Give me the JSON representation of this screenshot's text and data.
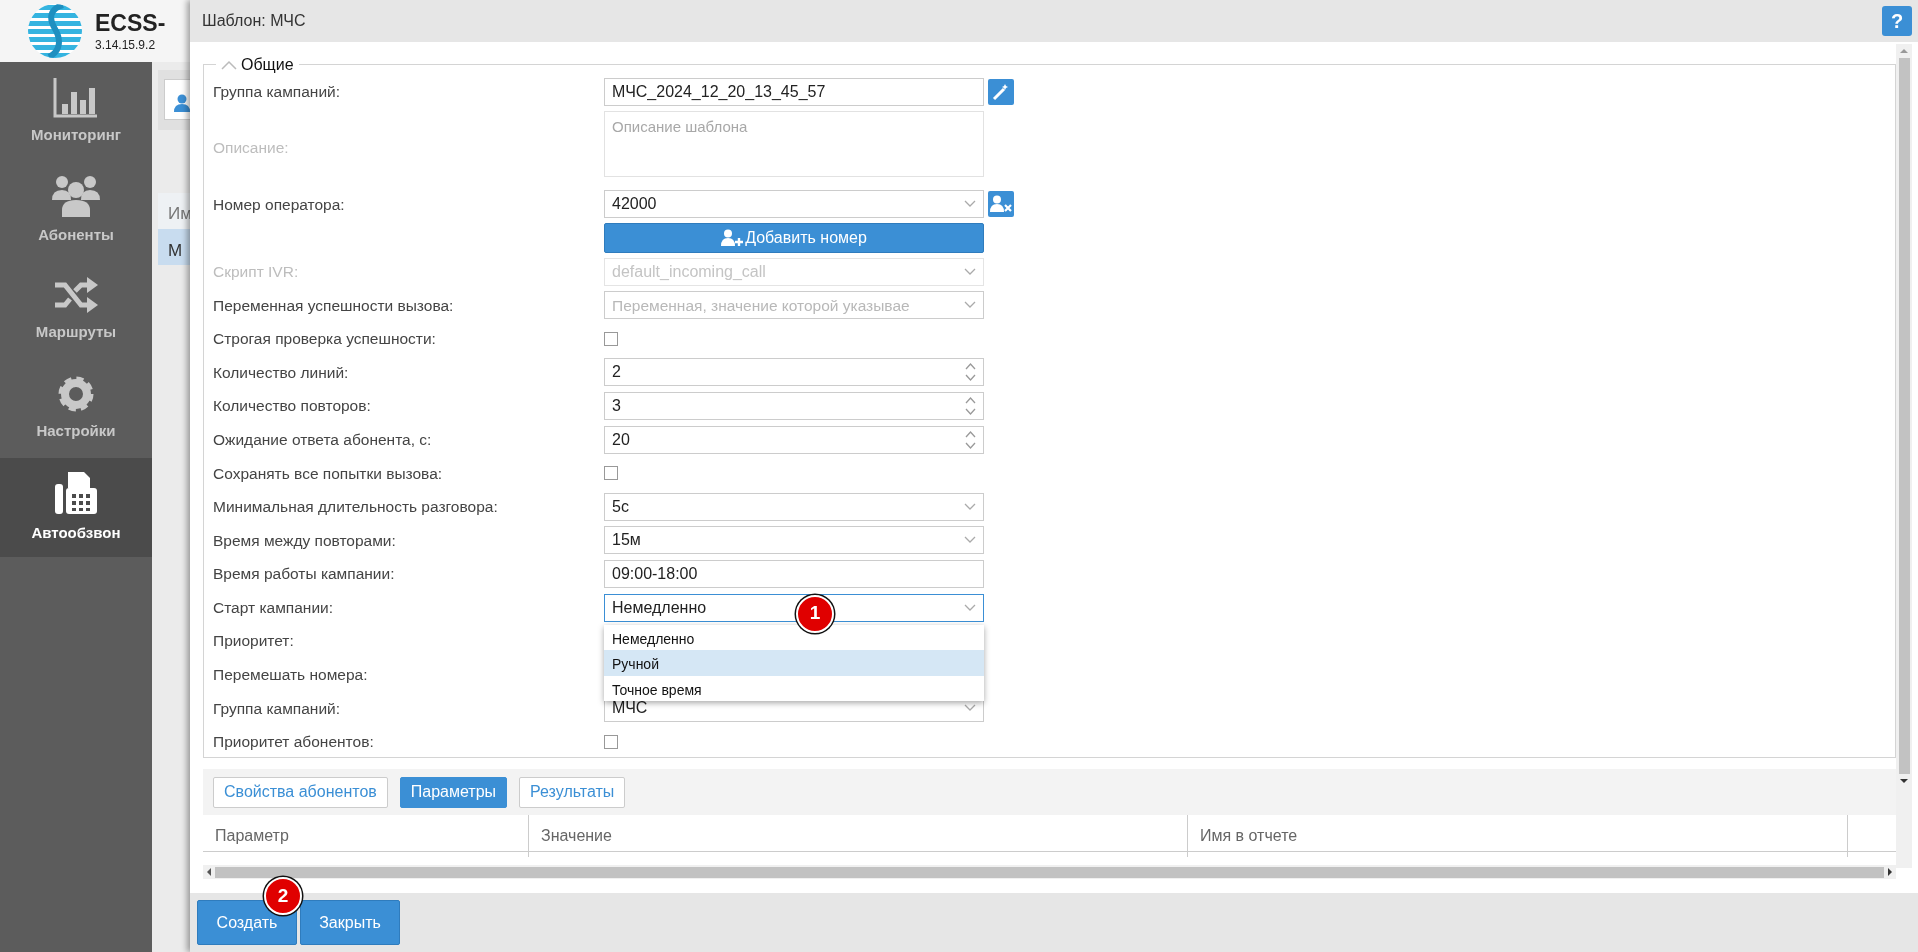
{
  "app": {
    "title": "ECSS-",
    "version": "3.14.15.9.2"
  },
  "sidebar": {
    "items": [
      {
        "label": "Мониторинг",
        "selected": false
      },
      {
        "label": "Абоненты",
        "selected": false
      },
      {
        "label": "Маршруты",
        "selected": false
      },
      {
        "label": "Настройки",
        "selected": false
      },
      {
        "label": "Автообзвон",
        "selected": true
      }
    ]
  },
  "background": {
    "column_header": "Им",
    "row_cell": "М"
  },
  "dialog": {
    "title": "Шаблон: МЧС",
    "help": "?"
  },
  "section": {
    "title": "Общие",
    "expanded": true
  },
  "fields": [
    {
      "kind": "text",
      "label": "Группа кампаний:",
      "value": "МЧС_2024_12_20_13_45_57",
      "side_button": true,
      "disabled": false
    },
    {
      "kind": "textarea",
      "label": "Описание:",
      "placeholder": "Описание шаблона",
      "disabled": true
    },
    {
      "kind": "select",
      "label": "Номер оператора:",
      "value": "42000",
      "side_button": true,
      "disabled": false
    },
    {
      "kind": "button",
      "text": "Добавить номер",
      "disabled": false
    },
    {
      "kind": "select",
      "label": "Скрипт IVR:",
      "value": "default_incoming_call",
      "disabled": true
    },
    {
      "kind": "select",
      "label": "Переменная успешности вызова:",
      "placeholder": "Переменная, значение которой указывае",
      "disabled": false
    },
    {
      "kind": "checkbox",
      "label": "Строгая проверка успешности:",
      "checked": false,
      "disabled": false
    },
    {
      "kind": "number",
      "label": "Количество линий:",
      "value": "2",
      "disabled": false
    },
    {
      "kind": "number",
      "label": "Количество повторов:",
      "value": "3",
      "disabled": false
    },
    {
      "kind": "number",
      "label": "Ожидание ответа абонента, с:",
      "value": "20",
      "disabled": false
    },
    {
      "kind": "checkbox",
      "label": "Сохранять все попытки вызова:",
      "checked": false,
      "disabled": false
    },
    {
      "kind": "select",
      "label": "Минимальная длительность разговора:",
      "value": "5с",
      "disabled": false
    },
    {
      "kind": "select",
      "label": "Время между повторами:",
      "value": "15м",
      "disabled": false
    },
    {
      "kind": "text",
      "label": "Время работы кампании:",
      "value": "09:00-18:00",
      "disabled": false
    },
    {
      "kind": "select",
      "label": "Старт кампании:",
      "value": "Немедленно",
      "disabled": false,
      "open": true,
      "options": [
        {
          "label": "Немедленно",
          "highlighted": false
        },
        {
          "label": "Ручной",
          "highlighted": true
        },
        {
          "label": "Точное время",
          "highlighted": false
        }
      ]
    },
    {
      "kind": "covered",
      "label": "Приоритет:",
      "disabled": false
    },
    {
      "kind": "covered",
      "label": "Перемешать номера:",
      "disabled": false
    },
    {
      "kind": "select",
      "label": "Группа кампаний:",
      "value": "МЧС",
      "disabled": false
    },
    {
      "kind": "checkbox",
      "label": "Приоритет абонентов:",
      "checked": false,
      "disabled": false
    }
  ],
  "tabs": [
    {
      "label": "Свойства абонентов",
      "selected": false
    },
    {
      "label": "Параметры",
      "selected": true
    },
    {
      "label": "Результаты",
      "selected": false
    }
  ],
  "table": {
    "columns": [
      "Параметр",
      "Значение",
      "Имя в отчете"
    ]
  },
  "buttons": [
    "Создать",
    "Закрыть"
  ],
  "annotations": [
    {
      "label": "1"
    },
    {
      "label": "2"
    }
  ]
}
